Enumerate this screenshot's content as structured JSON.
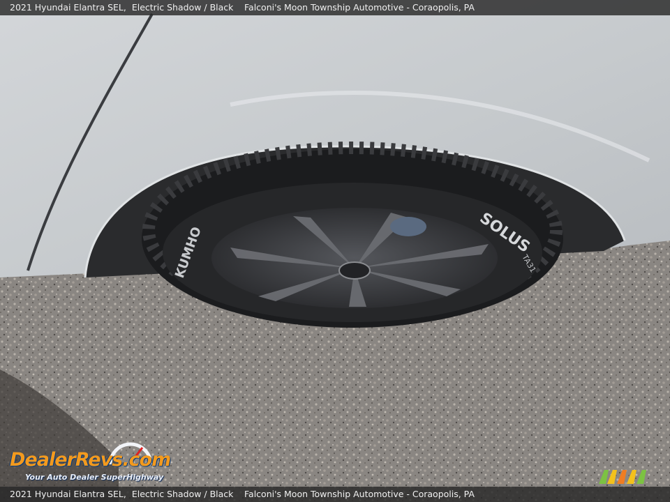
{
  "caption": {
    "vehicle": "2021 Hyundai Elantra SEL,",
    "color": "Electric Shadow / Black",
    "dealer": "Falconi's Moon Township Automotive - Coraopolis, PA"
  },
  "tire_text": {
    "brand": "KUMHO",
    "model": "SOLUS",
    "model_code": "TA31"
  },
  "watermark": {
    "brand": "DealerRevs.com",
    "tagline": "Your Auto Dealer SuperHighway"
  },
  "colors": {
    "body_paint": "#c9cdd1",
    "gravel": "#8a8682",
    "tire": "#1b1c1e",
    "rim": "#3e3f43",
    "caption_bar": "#2a2a2a",
    "watermark_orange": "#f39a1e",
    "watermark_blue": "#0b3c7a"
  }
}
